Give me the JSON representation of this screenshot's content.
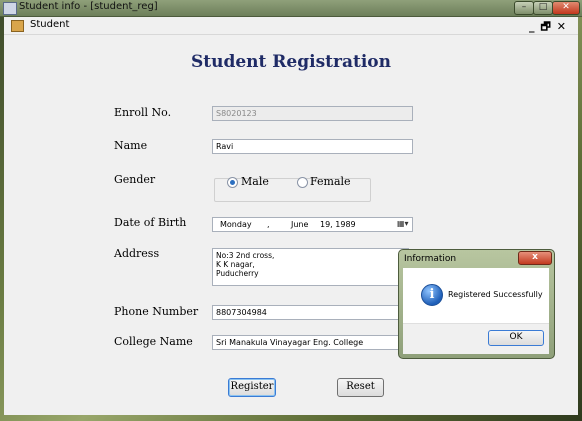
{
  "window": {
    "title": "Student info - [student_reg]"
  },
  "mdi_child": {
    "title": "Student"
  },
  "form": {
    "heading": "Student Registration",
    "labels": {
      "enroll": "Enroll No.",
      "name": "Name",
      "gender": "Gender",
      "dob": "Date of Birth",
      "address": "Address",
      "phone": "Phone Number",
      "college": "College Name"
    },
    "values": {
      "enroll": "S8020123",
      "name": "Ravi",
      "address_lines": [
        "No:3 2nd cross,",
        "K K nagar,",
        "Puducherry"
      ],
      "phone": "8807304984",
      "college": "Sri Manakula Vinayagar Eng. College"
    },
    "gender": {
      "male": "Male",
      "female": "Female",
      "selected": "Male"
    },
    "dob": {
      "weekday": "Monday",
      "sep": ",",
      "month": "June",
      "day_year": "19, 1989"
    },
    "buttons": {
      "register": "Register",
      "reset": "Reset"
    }
  },
  "dialog": {
    "title": "Information",
    "close": "x",
    "message": "Registered Successfully",
    "ok": "OK",
    "icon": "info-icon"
  },
  "colors": {
    "heading": "#1f2b66",
    "accent": "#3a7bd5",
    "close_red": "#c23a1f"
  }
}
